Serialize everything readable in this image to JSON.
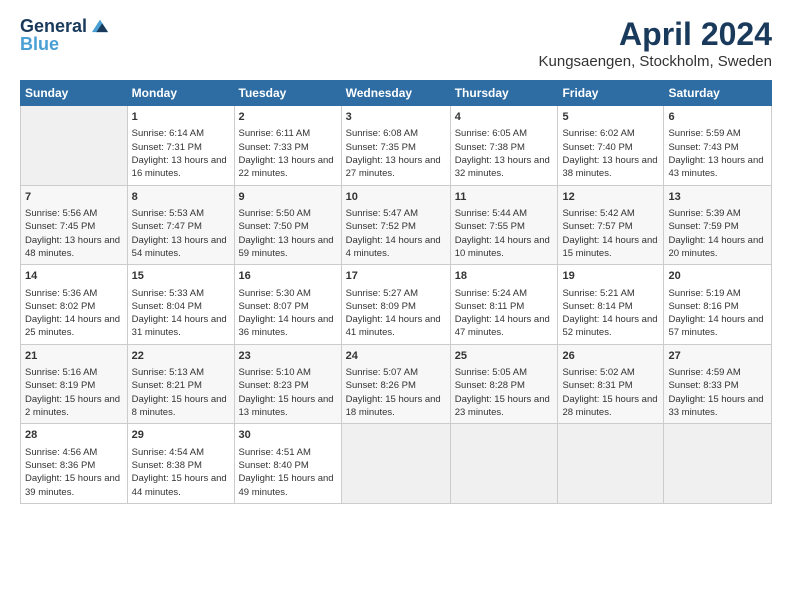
{
  "app": {
    "logo_line1": "General",
    "logo_line2": "Blue"
  },
  "header": {
    "title": "April 2024",
    "location": "Kungsaengen, Stockholm, Sweden"
  },
  "weekdays": [
    "Sunday",
    "Monday",
    "Tuesday",
    "Wednesday",
    "Thursday",
    "Friday",
    "Saturday"
  ],
  "weeks": [
    [
      {
        "day": "",
        "empty": true
      },
      {
        "day": "1",
        "sunrise": "Sunrise: 6:14 AM",
        "sunset": "Sunset: 7:31 PM",
        "daylight": "Daylight: 13 hours and 16 minutes."
      },
      {
        "day": "2",
        "sunrise": "Sunrise: 6:11 AM",
        "sunset": "Sunset: 7:33 PM",
        "daylight": "Daylight: 13 hours and 22 minutes."
      },
      {
        "day": "3",
        "sunrise": "Sunrise: 6:08 AM",
        "sunset": "Sunset: 7:35 PM",
        "daylight": "Daylight: 13 hours and 27 minutes."
      },
      {
        "day": "4",
        "sunrise": "Sunrise: 6:05 AM",
        "sunset": "Sunset: 7:38 PM",
        "daylight": "Daylight: 13 hours and 32 minutes."
      },
      {
        "day": "5",
        "sunrise": "Sunrise: 6:02 AM",
        "sunset": "Sunset: 7:40 PM",
        "daylight": "Daylight: 13 hours and 38 minutes."
      },
      {
        "day": "6",
        "sunrise": "Sunrise: 5:59 AM",
        "sunset": "Sunset: 7:43 PM",
        "daylight": "Daylight: 13 hours and 43 minutes."
      }
    ],
    [
      {
        "day": "7",
        "sunrise": "Sunrise: 5:56 AM",
        "sunset": "Sunset: 7:45 PM",
        "daylight": "Daylight: 13 hours and 48 minutes."
      },
      {
        "day": "8",
        "sunrise": "Sunrise: 5:53 AM",
        "sunset": "Sunset: 7:47 PM",
        "daylight": "Daylight: 13 hours and 54 minutes."
      },
      {
        "day": "9",
        "sunrise": "Sunrise: 5:50 AM",
        "sunset": "Sunset: 7:50 PM",
        "daylight": "Daylight: 13 hours and 59 minutes."
      },
      {
        "day": "10",
        "sunrise": "Sunrise: 5:47 AM",
        "sunset": "Sunset: 7:52 PM",
        "daylight": "Daylight: 14 hours and 4 minutes."
      },
      {
        "day": "11",
        "sunrise": "Sunrise: 5:44 AM",
        "sunset": "Sunset: 7:55 PM",
        "daylight": "Daylight: 14 hours and 10 minutes."
      },
      {
        "day": "12",
        "sunrise": "Sunrise: 5:42 AM",
        "sunset": "Sunset: 7:57 PM",
        "daylight": "Daylight: 14 hours and 15 minutes."
      },
      {
        "day": "13",
        "sunrise": "Sunrise: 5:39 AM",
        "sunset": "Sunset: 7:59 PM",
        "daylight": "Daylight: 14 hours and 20 minutes."
      }
    ],
    [
      {
        "day": "14",
        "sunrise": "Sunrise: 5:36 AM",
        "sunset": "Sunset: 8:02 PM",
        "daylight": "Daylight: 14 hours and 25 minutes."
      },
      {
        "day": "15",
        "sunrise": "Sunrise: 5:33 AM",
        "sunset": "Sunset: 8:04 PM",
        "daylight": "Daylight: 14 hours and 31 minutes."
      },
      {
        "day": "16",
        "sunrise": "Sunrise: 5:30 AM",
        "sunset": "Sunset: 8:07 PM",
        "daylight": "Daylight: 14 hours and 36 minutes."
      },
      {
        "day": "17",
        "sunrise": "Sunrise: 5:27 AM",
        "sunset": "Sunset: 8:09 PM",
        "daylight": "Daylight: 14 hours and 41 minutes."
      },
      {
        "day": "18",
        "sunrise": "Sunrise: 5:24 AM",
        "sunset": "Sunset: 8:11 PM",
        "daylight": "Daylight: 14 hours and 47 minutes."
      },
      {
        "day": "19",
        "sunrise": "Sunrise: 5:21 AM",
        "sunset": "Sunset: 8:14 PM",
        "daylight": "Daylight: 14 hours and 52 minutes."
      },
      {
        "day": "20",
        "sunrise": "Sunrise: 5:19 AM",
        "sunset": "Sunset: 8:16 PM",
        "daylight": "Daylight: 14 hours and 57 minutes."
      }
    ],
    [
      {
        "day": "21",
        "sunrise": "Sunrise: 5:16 AM",
        "sunset": "Sunset: 8:19 PM",
        "daylight": "Daylight: 15 hours and 2 minutes."
      },
      {
        "day": "22",
        "sunrise": "Sunrise: 5:13 AM",
        "sunset": "Sunset: 8:21 PM",
        "daylight": "Daylight: 15 hours and 8 minutes."
      },
      {
        "day": "23",
        "sunrise": "Sunrise: 5:10 AM",
        "sunset": "Sunset: 8:23 PM",
        "daylight": "Daylight: 15 hours and 13 minutes."
      },
      {
        "day": "24",
        "sunrise": "Sunrise: 5:07 AM",
        "sunset": "Sunset: 8:26 PM",
        "daylight": "Daylight: 15 hours and 18 minutes."
      },
      {
        "day": "25",
        "sunrise": "Sunrise: 5:05 AM",
        "sunset": "Sunset: 8:28 PM",
        "daylight": "Daylight: 15 hours and 23 minutes."
      },
      {
        "day": "26",
        "sunrise": "Sunrise: 5:02 AM",
        "sunset": "Sunset: 8:31 PM",
        "daylight": "Daylight: 15 hours and 28 minutes."
      },
      {
        "day": "27",
        "sunrise": "Sunrise: 4:59 AM",
        "sunset": "Sunset: 8:33 PM",
        "daylight": "Daylight: 15 hours and 33 minutes."
      }
    ],
    [
      {
        "day": "28",
        "sunrise": "Sunrise: 4:56 AM",
        "sunset": "Sunset: 8:36 PM",
        "daylight": "Daylight: 15 hours and 39 minutes."
      },
      {
        "day": "29",
        "sunrise": "Sunrise: 4:54 AM",
        "sunset": "Sunset: 8:38 PM",
        "daylight": "Daylight: 15 hours and 44 minutes."
      },
      {
        "day": "30",
        "sunrise": "Sunrise: 4:51 AM",
        "sunset": "Sunset: 8:40 PM",
        "daylight": "Daylight: 15 hours and 49 minutes."
      },
      {
        "day": "",
        "empty": true
      },
      {
        "day": "",
        "empty": true
      },
      {
        "day": "",
        "empty": true
      },
      {
        "day": "",
        "empty": true
      }
    ]
  ]
}
